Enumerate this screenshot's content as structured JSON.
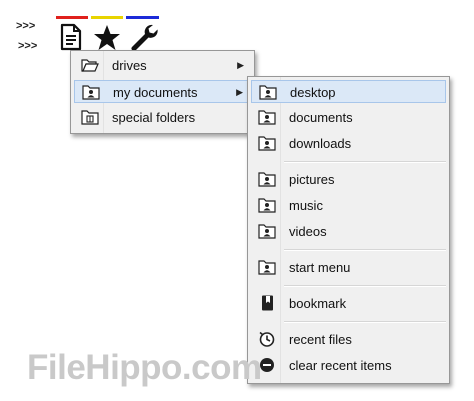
{
  "toolbar": {
    "arrow_top": ">>>",
    "arrow_bottom": ">>>",
    "icons": [
      "document-icon",
      "star-icon",
      "wrench-icon"
    ],
    "bar_colors": [
      "#e0201c",
      "#e8d400",
      "#1c2ad8"
    ]
  },
  "menu_main": {
    "items": [
      {
        "label": "drives",
        "icon": "open-folder-icon",
        "submenu": "▶"
      },
      {
        "label": "my documents",
        "icon": "user-folder-icon",
        "submenu": "▶"
      },
      {
        "label": "special folders",
        "icon": "special-folder-icon"
      }
    ]
  },
  "menu_docs": {
    "items": [
      {
        "label": "desktop",
        "icon": "user-folder-icon"
      },
      {
        "label": "documents",
        "icon": "user-folder-icon"
      },
      {
        "label": "downloads",
        "icon": "user-folder-icon"
      },
      {
        "label": "pictures",
        "icon": "user-folder-icon"
      },
      {
        "label": "music",
        "icon": "user-folder-icon"
      },
      {
        "label": "videos",
        "icon": "user-folder-icon"
      },
      {
        "label": "start menu",
        "icon": "user-folder-icon"
      },
      {
        "label": "bookmark",
        "icon": "bookmark-icon"
      },
      {
        "label": "recent files",
        "icon": "clock-icon"
      },
      {
        "label": "clear recent items",
        "icon": "clear-icon"
      }
    ]
  },
  "watermark": "FileHippo.com",
  "colors": {
    "menu_bg": "#f0f0f0",
    "highlight": "#dbe8f7",
    "highlight_border": "#a8c6ea"
  }
}
